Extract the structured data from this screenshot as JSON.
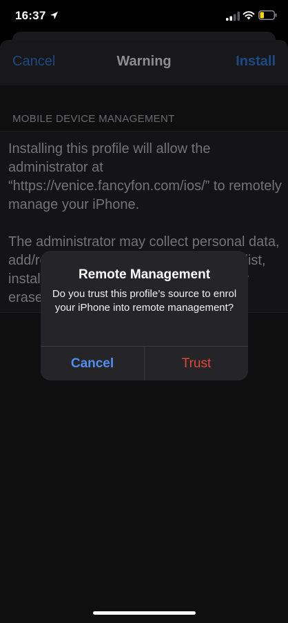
{
  "status_bar": {
    "time": "16:37",
    "icons": [
      "location-arrow-icon",
      "cellular-signal-icon",
      "wifi-icon",
      "battery-low-icon"
    ],
    "battery_color": "#ffd60a"
  },
  "nav": {
    "cancel_label": "Cancel",
    "title": "Warning",
    "install_label": "Install"
  },
  "section": {
    "header": "MOBILE DEVICE MANAGEMENT",
    "body": "Installing this profile will allow the administrator at “https://venice.fancyfon.com/ios/” to remotely manage your iPhone.\n\nThe administrator may collect personal data, add/remove accounts and restrictions, list, install, and manage apps, and remotely erase data on your iPhone."
  },
  "alert": {
    "title": "Remote Management",
    "message": "Do you trust this profile’s source to enrol your iPhone into remote management?",
    "cancel_label": "Cancel",
    "trust_label": "Trust"
  },
  "colors": {
    "accent_blue": "#4f8ff0",
    "destructive_red": "#e0473c"
  }
}
